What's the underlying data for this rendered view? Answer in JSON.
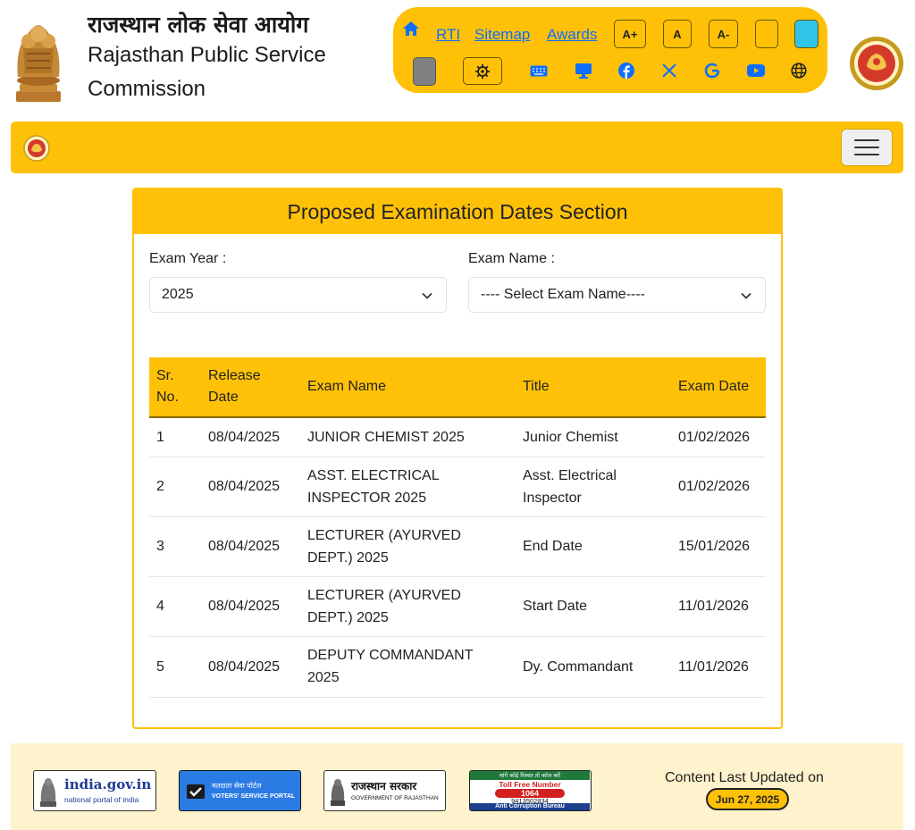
{
  "header": {
    "title_hindi": "राजस्थान लोक सेवा आयोग",
    "title_english_line1": "Rajasthan Public Service",
    "title_english_line2": "Commission"
  },
  "toolbar": {
    "links": [
      "RTI",
      "Sitemap",
      "Awards"
    ],
    "font_buttons": [
      "A+",
      "A",
      "A-"
    ],
    "theme_swatches": [
      "#ffc107",
      "#2ec5e8",
      "#808080"
    ],
    "icons": [
      "home-icon",
      "gear-icon",
      "keyboard-icon",
      "monitor-icon",
      "facebook-icon",
      "x-twitter-icon",
      "google-icon",
      "youtube-icon",
      "globe-icon"
    ],
    "accent_color": "#ffc107",
    "link_color": "#0d6efd"
  },
  "card": {
    "title": "Proposed Examination Dates Section",
    "exam_year_label": "Exam Year :",
    "exam_year_value": "2025",
    "exam_name_label": "Exam Name :",
    "exam_name_value": "---- Select Exam Name----"
  },
  "table": {
    "headers": [
      "Sr. No.",
      "Release Date",
      "Exam Name",
      "Title",
      "Exam Date"
    ],
    "rows": [
      {
        "sr": "1",
        "release": "08/04/2025",
        "exam": "JUNIOR CHEMIST 2025",
        "title": "Junior Chemist",
        "date": "01/02/2026"
      },
      {
        "sr": "2",
        "release": "08/04/2025",
        "exam": "ASST. ELECTRICAL INSPECTOR 2025",
        "title": "Asst. Electrical Inspector",
        "date": "01/02/2026"
      },
      {
        "sr": "3",
        "release": "08/04/2025",
        "exam": "LECTURER (AYURVED DEPT.) 2025",
        "title": "End Date",
        "date": "15/01/2026"
      },
      {
        "sr": "4",
        "release": "08/04/2025",
        "exam": "LECTURER (AYURVED DEPT.) 2025",
        "title": "Start Date",
        "date": "11/01/2026"
      },
      {
        "sr": "5",
        "release": "08/04/2025",
        "exam": "DEPUTY COMMANDANT 2025",
        "title": "Dy. Commandant",
        "date": "11/01/2026"
      }
    ]
  },
  "footer": {
    "india_gov_title": "india.gov.in",
    "india_gov_sub": "national portal of india",
    "voters_hindi": "मतदाता सेवा पोर्टल",
    "voters_english": "VOTERS' SERVICE PORTAL",
    "rajasthan_hindi": "राजस्थान सरकार",
    "rajasthan_english": "GOVERNMENT OF RAJASTHAN",
    "acb_top": "मांगे कोई रिश्वत तो कॉल करें",
    "acb_toll": "Toll Free Number",
    "acb_number": "1064",
    "acb_whatsapp": "9413502834",
    "acb_bureau": "Anti Corruption Bureau",
    "updated_label": "Content Last Updated on",
    "updated_date": "Jun 27, 2025"
  }
}
